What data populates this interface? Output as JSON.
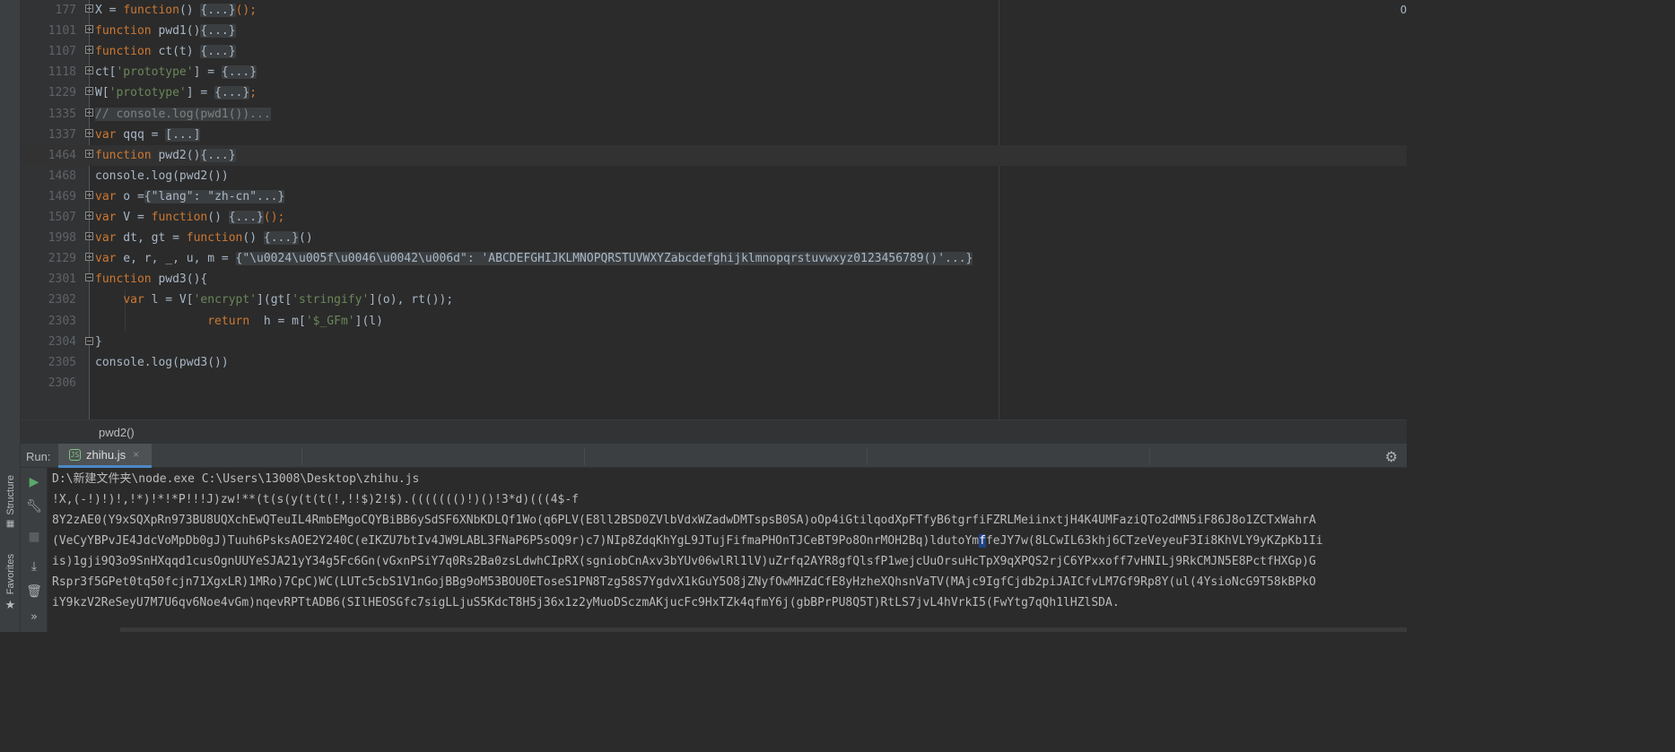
{
  "editor": {
    "lines": [
      {
        "num": "177",
        "segments": [
          [
            "X = ",
            ""
          ],
          [
            "function",
            "kw"
          ],
          [
            "() ",
            ""
          ],
          [
            "{...}",
            "fld"
          ],
          [
            "();",
            "kw"
          ]
        ],
        "fold": "closed"
      },
      {
        "num": "1101",
        "segments": [
          [
            "function",
            "kw"
          ],
          [
            " pwd1()",
            ""
          ],
          [
            "{...}",
            "fld"
          ]
        ],
        "fold": "closed"
      },
      {
        "num": "1107",
        "segments": [
          [
            "function",
            "kw"
          ],
          [
            " ct(t) ",
            ""
          ],
          [
            "{...}",
            "fld"
          ]
        ],
        "fold": "closed"
      },
      {
        "num": "1118",
        "segments": [
          [
            "ct[",
            ""
          ],
          [
            "'prototype'",
            "str"
          ],
          [
            "] = ",
            ""
          ],
          [
            "{...}",
            "fld"
          ]
        ],
        "fold": "closed"
      },
      {
        "num": "1229",
        "segments": [
          [
            "W[",
            ""
          ],
          [
            "'prototype'",
            "str"
          ],
          [
            "] = ",
            ""
          ],
          [
            "{...}",
            "fld"
          ],
          [
            ";",
            "kw"
          ]
        ],
        "fold": "closed"
      },
      {
        "num": "1335",
        "segments": [
          [
            "// console.log(pwd1())...",
            "fld-c"
          ]
        ],
        "fold": "closed"
      },
      {
        "num": "1337",
        "segments": [
          [
            "var",
            "kw"
          ],
          [
            " qqq = ",
            ""
          ],
          [
            "[...]",
            "fld"
          ]
        ],
        "fold": "closed"
      },
      {
        "num": "1464",
        "segments": [
          [
            "function",
            "kw"
          ],
          [
            " pwd2()",
            ""
          ],
          [
            "{...}",
            "fld"
          ]
        ],
        "fold": "closed",
        "current": true
      },
      {
        "num": "1468",
        "segments": [
          [
            "console.log(pwd2())",
            ""
          ]
        ],
        "fold": "none"
      },
      {
        "num": "1469",
        "segments": [
          [
            "var",
            "kw"
          ],
          [
            " o =",
            ""
          ],
          [
            "{\"lang\": \"zh-cn\"...}",
            "fld"
          ]
        ],
        "fold": "closed"
      },
      {
        "num": "1507",
        "segments": [
          [
            "var",
            "kw"
          ],
          [
            " V = ",
            ""
          ],
          [
            "function",
            "kw"
          ],
          [
            "() ",
            ""
          ],
          [
            "{...}",
            "fld"
          ],
          [
            "();",
            "kw"
          ]
        ],
        "fold": "closed"
      },
      {
        "num": "1998",
        "segments": [
          [
            "var",
            "kw"
          ],
          [
            " dt, gt = ",
            ""
          ],
          [
            "function",
            "kw"
          ],
          [
            "() ",
            ""
          ],
          [
            "{...}",
            "fld"
          ],
          [
            "()",
            ""
          ]
        ],
        "fold": "closed"
      },
      {
        "num": "2129",
        "segments": [
          [
            "var",
            "kw"
          ],
          [
            " e, r, _, u, m = ",
            ""
          ],
          [
            "{\"\\u0024\\u005f\\u0046\\u0042\\u006d\": 'ABCDEFGHIJKLMNOPQRSTUVWXYZabcdefghijklmnopqrstuvwxyz0123456789()'...}",
            "fld"
          ]
        ],
        "fold": "closed"
      },
      {
        "num": "2301",
        "segments": [
          [
            "function",
            "kw"
          ],
          [
            " pwd3(){",
            ""
          ]
        ],
        "fold": "open"
      },
      {
        "num": "2302",
        "segments": [
          [
            "    ",
            ""
          ],
          [
            "var",
            "kw"
          ],
          [
            " l = V[",
            ""
          ],
          [
            "'encrypt'",
            "str"
          ],
          [
            "](gt[",
            ""
          ],
          [
            "'stringify'",
            "str"
          ],
          [
            "](o), rt());",
            ""
          ]
        ],
        "fold": "none",
        "guide": true
      },
      {
        "num": "2303",
        "segments": [
          [
            "                ",
            ""
          ],
          [
            "return",
            "kw"
          ],
          [
            "  h = m[",
            ""
          ],
          [
            "'$_GFm'",
            "str"
          ],
          [
            "](l)",
            ""
          ]
        ],
        "fold": "none",
        "guide": true
      },
      {
        "num": "2304",
        "segments": [
          [
            "}",
            ""
          ]
        ],
        "fold": "end"
      },
      {
        "num": "2305",
        "segments": [
          [
            "console.log(pwd3())",
            ""
          ]
        ],
        "fold": "none"
      },
      {
        "num": "2306",
        "segments": [],
        "fold": "none"
      }
    ],
    "corner_text": "O"
  },
  "breadcrumb": {
    "text": "pwd2()"
  },
  "run": {
    "label": "Run:",
    "tab_label": "zhihu.js",
    "tab_close": "×",
    "tab_icon": "JS"
  },
  "side_tabs": {
    "structure": "Structure",
    "favorites": "Favorites"
  },
  "toolbar_icons": [
    "rerun-icon",
    "wrench-icon",
    "stop-icon",
    "scroll-to-end-icon",
    "trash-icon",
    "more-icon"
  ],
  "console": {
    "lines": [
      "D:\\新建文件夹\\node.exe C:\\Users\\13008\\Desktop\\zhihu.js",
      "!X,(-!)!)!,!*)!*!*P!!!J)zw!**(t(s(y(t(t(!,!!$)2!$).((((((()!)()!3*d)(((4$-f",
      "8Y2zAE0(Y9xSQXpRn973BU8UQXchEwQTeuIL4RmbEMgoCQYBiBB6ySdSF6XNbKDLQf1Wo(q6PLV(E8ll2BSD0ZVlbVdxWZadwDMTspsB0SA)oOp4iGtilqodXpFTfyB6tgrfiFZRLMeiinxtjH4K4UMFaziQTo2dMN5iF86J8o1ZCTxWahrA",
      "(VeCyYBPvJE4JdcVoMpDb0gJ)Tuuh6PsksAOE2Y240C(eIKZU7btIv4JW9LABL3FNaP6P5sOQ9r)c7)NIp8ZdqKhYgL9JTujFifmaPHOnTJCeBT9Po8OnrMOH2Bq)ldutoYm",
      "feJY7w(8LCwIL63khj6CTzeVeyeuF3Ii8KhVLY9yKZpKb1Ii",
      "is)1gji9Q3o9SnHXqqd1cusOgnUUYeSJA21yY34g5Fc6Gn(vGxnPSiY7q0Rs2Ba0zsLdwhCIpRX(sgniobCnAxv3bYUv06wlRl1lV)uZrfq2AYR8gfQlsfP1wejcUuOrsuHcTpX9qXPQS2rjC6YPxxoff7vHNILj9RkCMJN5E8PctfHXGp)G",
      "Rspr3f5GPet0tq50fcjn71XgxLR)1MRo)7CpC)WC(LUTc5cbS1V1nGojBBg9oM53BOU0EToseS1PN8Tzg58S7YgdvX1kGuY5O8jZNyfOwMHZdCfE8yHzheXQhsnVaTV(MAjc9IgfCjdb2piJAICfvLM7Gf9Rp8Y(ul(4YsioNcG9T58kBPkO",
      "iY9kzV2ReSeyU7M7U6qv6Noe4vGm)nqevRPTtADB6(SIlHEOSGfc7sigLLjuS5KdcT8H5j36x1z2yMuoDSczmAKjucFc9HxTZk4qfmY6j(gbBPrPU8Q5T)RtLS7jvL4hVrkI5(FwYtg7qQh1lHZlSDA."
    ]
  }
}
